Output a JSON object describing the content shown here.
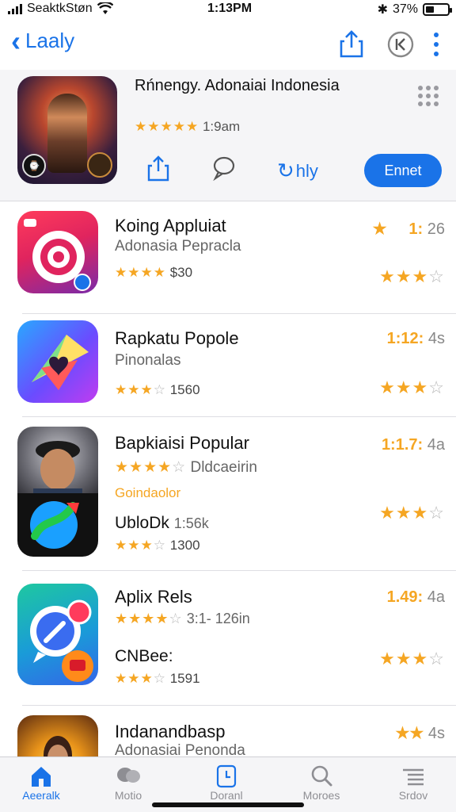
{
  "status": {
    "carrier": "SeaktkStøn",
    "time": "1:13PM",
    "battery": "37%",
    "battery_fraction": 0.37
  },
  "nav": {
    "back_label": "Laaly"
  },
  "featured": {
    "title": "Rńnengy. Adonaiai Indonesia",
    "stars": "★★★★★",
    "rating_text": "1:9am",
    "open_label": "Ennet",
    "like_label": "hly"
  },
  "apps": [
    {
      "title": "Koing Appluiat",
      "sub": "Adonasia  Pepracla",
      "stars": "★★★★",
      "stars_off": "",
      "rating": "$30",
      "time_hl": "1:",
      "time_rest": "26",
      "time_icon": "★",
      "right_stars": "★★★",
      "right_off": "☆"
    },
    {
      "title": "Rapkatu Popole",
      "sub": "Pinonalas",
      "stars": "★★★",
      "stars_off": "☆",
      "rating": "1560",
      "time_hl": "1:12:",
      "time_rest": "4s",
      "right_stars": "★★★",
      "right_off": "☆"
    },
    {
      "title": "Bapkiaisi Popular",
      "sub": "Dldcaeirin",
      "stars": "★★★★",
      "stars_off": "☆",
      "rating": "",
      "tag": "Goindaolor",
      "sub2_title": "UbloDk",
      "sub2_rating": "1:56k",
      "stars2": "★★★",
      "stars2_off": "☆",
      "rating2": "1300",
      "time_hl": "1:1.7:",
      "time_rest": "4a",
      "right_stars": "★★★",
      "right_off": "☆"
    },
    {
      "title": "Aplix Rels",
      "sub": "",
      "stars": "★★★★",
      "stars_off": "☆",
      "rating": "3:1- 126in",
      "sub2_title": "CNBee:",
      "stars2": "★★★",
      "stars2_off": "☆",
      "rating2": "1591",
      "time_hl": "1.49:",
      "time_rest": "4a",
      "right_stars": "★★★",
      "right_off": "☆"
    },
    {
      "title": "Indanandbasp",
      "sub": "Adonasiai  Penonda",
      "time_hl": "★★",
      "time_rest": "4s"
    }
  ],
  "tabs": [
    {
      "label": "Aeeralk",
      "icon": "home-icon"
    },
    {
      "label": "Motio",
      "icon": "chat-icon"
    },
    {
      "label": "Doranl",
      "icon": "clock-icon"
    },
    {
      "label": "Moroes",
      "icon": "search-icon"
    },
    {
      "label": "Srdov",
      "icon": "list-icon"
    }
  ],
  "colors": {
    "accent": "#1a73e8",
    "star": "#f5a623"
  }
}
